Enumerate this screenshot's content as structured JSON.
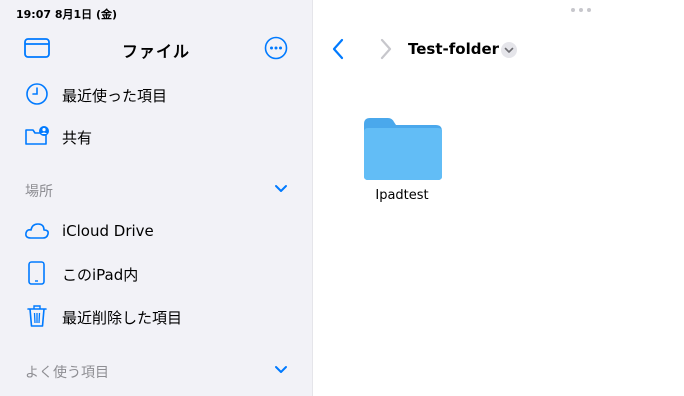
{
  "status_bar": {
    "time": "19:07  8月1日 (金)"
  },
  "sidebar": {
    "title": "ファイル",
    "items": [
      {
        "label": "最近使った項目",
        "icon": "clock-icon"
      },
      {
        "label": "共有",
        "icon": "shared-folder-icon"
      }
    ],
    "sections": [
      {
        "title": "場所",
        "items": [
          {
            "label": "iCloud Drive",
            "icon": "cloud-icon"
          },
          {
            "label": "このiPad内",
            "icon": "ipad-icon"
          },
          {
            "label": "最近削除した項目",
            "icon": "trash-icon"
          }
        ]
      },
      {
        "title": "よく使う項目",
        "items": []
      }
    ]
  },
  "main": {
    "folder_title": "Test-folder",
    "files": [
      {
        "name": "Ipadtest",
        "type": "folder",
        "icon": "folder-icon"
      }
    ]
  },
  "colors": {
    "accent": "#007aff",
    "sidebar_bg": "#f2f2f7",
    "folder": "#5fb8f5",
    "secondary_text": "#8e8e93"
  }
}
